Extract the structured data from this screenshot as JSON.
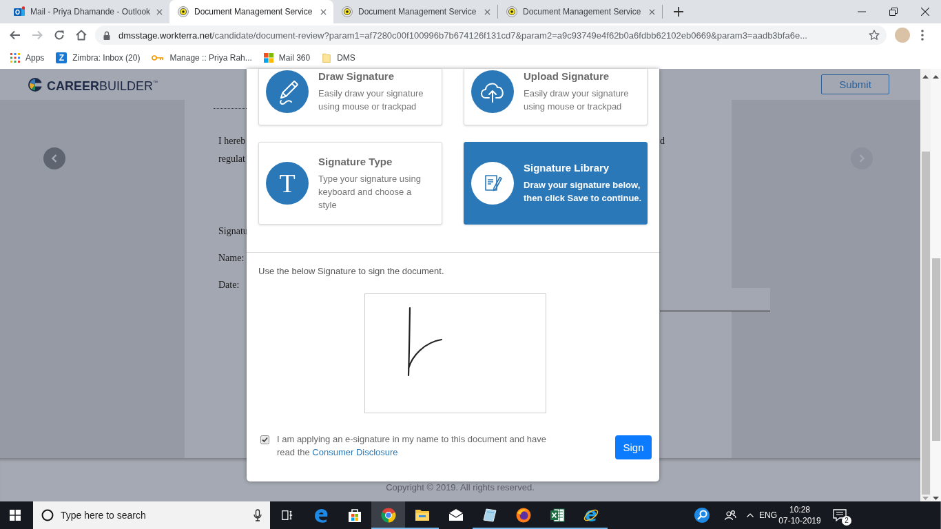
{
  "browser": {
    "tabs": [
      {
        "title": "Mail - Priya Dhamande - Outlook",
        "kind": "mail",
        "selected": false
      },
      {
        "title": "Document Management Service",
        "kind": "dms",
        "selected": true
      },
      {
        "title": "Document Management Service",
        "kind": "dms",
        "selected": false
      },
      {
        "title": "Document Management Service",
        "kind": "dms",
        "selected": false
      }
    ],
    "url": {
      "host": "dmsstage.workterra.net",
      "path": "/candidate/document-review?param1=af7280c00f100996b7b674126f131cd7&param2=a9c93749e4f62b0a6fdbb62102eb0669&param3=aadb3bfa6e..."
    },
    "bookmarks": [
      {
        "label": "Apps",
        "kind": "apps"
      },
      {
        "label": "Zimbra: Inbox (20)",
        "kind": "letter",
        "icon_text": "Z"
      },
      {
        "label": "Manage :: Priya Rah...",
        "kind": "key"
      },
      {
        "label": "Mail 360",
        "kind": "squares"
      },
      {
        "label": "DMS",
        "kind": "folder"
      }
    ]
  },
  "page": {
    "logo": "**CAREER**BUILDER$^{™}$",
    "submit_button": "Submit",
    "document": {
      "text_lines": [
        {
          "start": "I hereb",
          "end": "d"
        },
        {
          "start": "regulat"
        }
      ],
      "field_labels": [
        "Signatu",
        "Name:",
        "Date:"
      ]
    },
    "footer": "Copyright © 2019. All rights reserved."
  },
  "dialog": {
    "options": [
      {
        "kind": "draw",
        "title": "Draw Signature",
        "description": "Easily draw your signature using mouse or trackpad",
        "selected": false
      },
      {
        "kind": "upload",
        "title": "Upload Signature",
        "description": "Easily draw your signature using mouse or trackpad",
        "selected": false
      },
      {
        "kind": "type",
        "icon_text": "T",
        "title": "Signature Type",
        "description": "Type your signature using keyboard and choose a style",
        "selected": false
      },
      {
        "kind": "library",
        "title": "Signature Library",
        "description": "Draw your signature below, then click Save to continue.",
        "selected": true
      }
    ],
    "instruction": "Use the below Signature to sign the document.",
    "consent": {
      "checked": true,
      "text": "I am applying an e-signature in my name to this document and have read the",
      "link": "Consumer Disclosure"
    },
    "sign_button": "Sign"
  },
  "taskbar": {
    "search_placeholder": "Type here to search",
    "apps": [
      {
        "kind": "task_view",
        "selected": false,
        "running": false
      },
      {
        "kind": "swirl",
        "selected": false,
        "running": false
      },
      {
        "kind": "store",
        "selected": false,
        "running": false
      },
      {
        "kind": "tricolor",
        "selected": true,
        "running": true
      },
      {
        "kind": "folder",
        "selected": false,
        "running": true
      },
      {
        "kind": "envelope",
        "selected": false,
        "running": false
      },
      {
        "kind": "tablet",
        "selected": false,
        "running": true
      },
      {
        "kind": "globe",
        "selected": false,
        "running": true
      },
      {
        "kind": "sheet",
        "selected": false,
        "running": true
      },
      {
        "kind": "orbit",
        "selected": false,
        "running": true
      }
    ],
    "language": "ENG",
    "time": "10:28",
    "date": "07-10-2019",
    "notification_count": "2"
  }
}
